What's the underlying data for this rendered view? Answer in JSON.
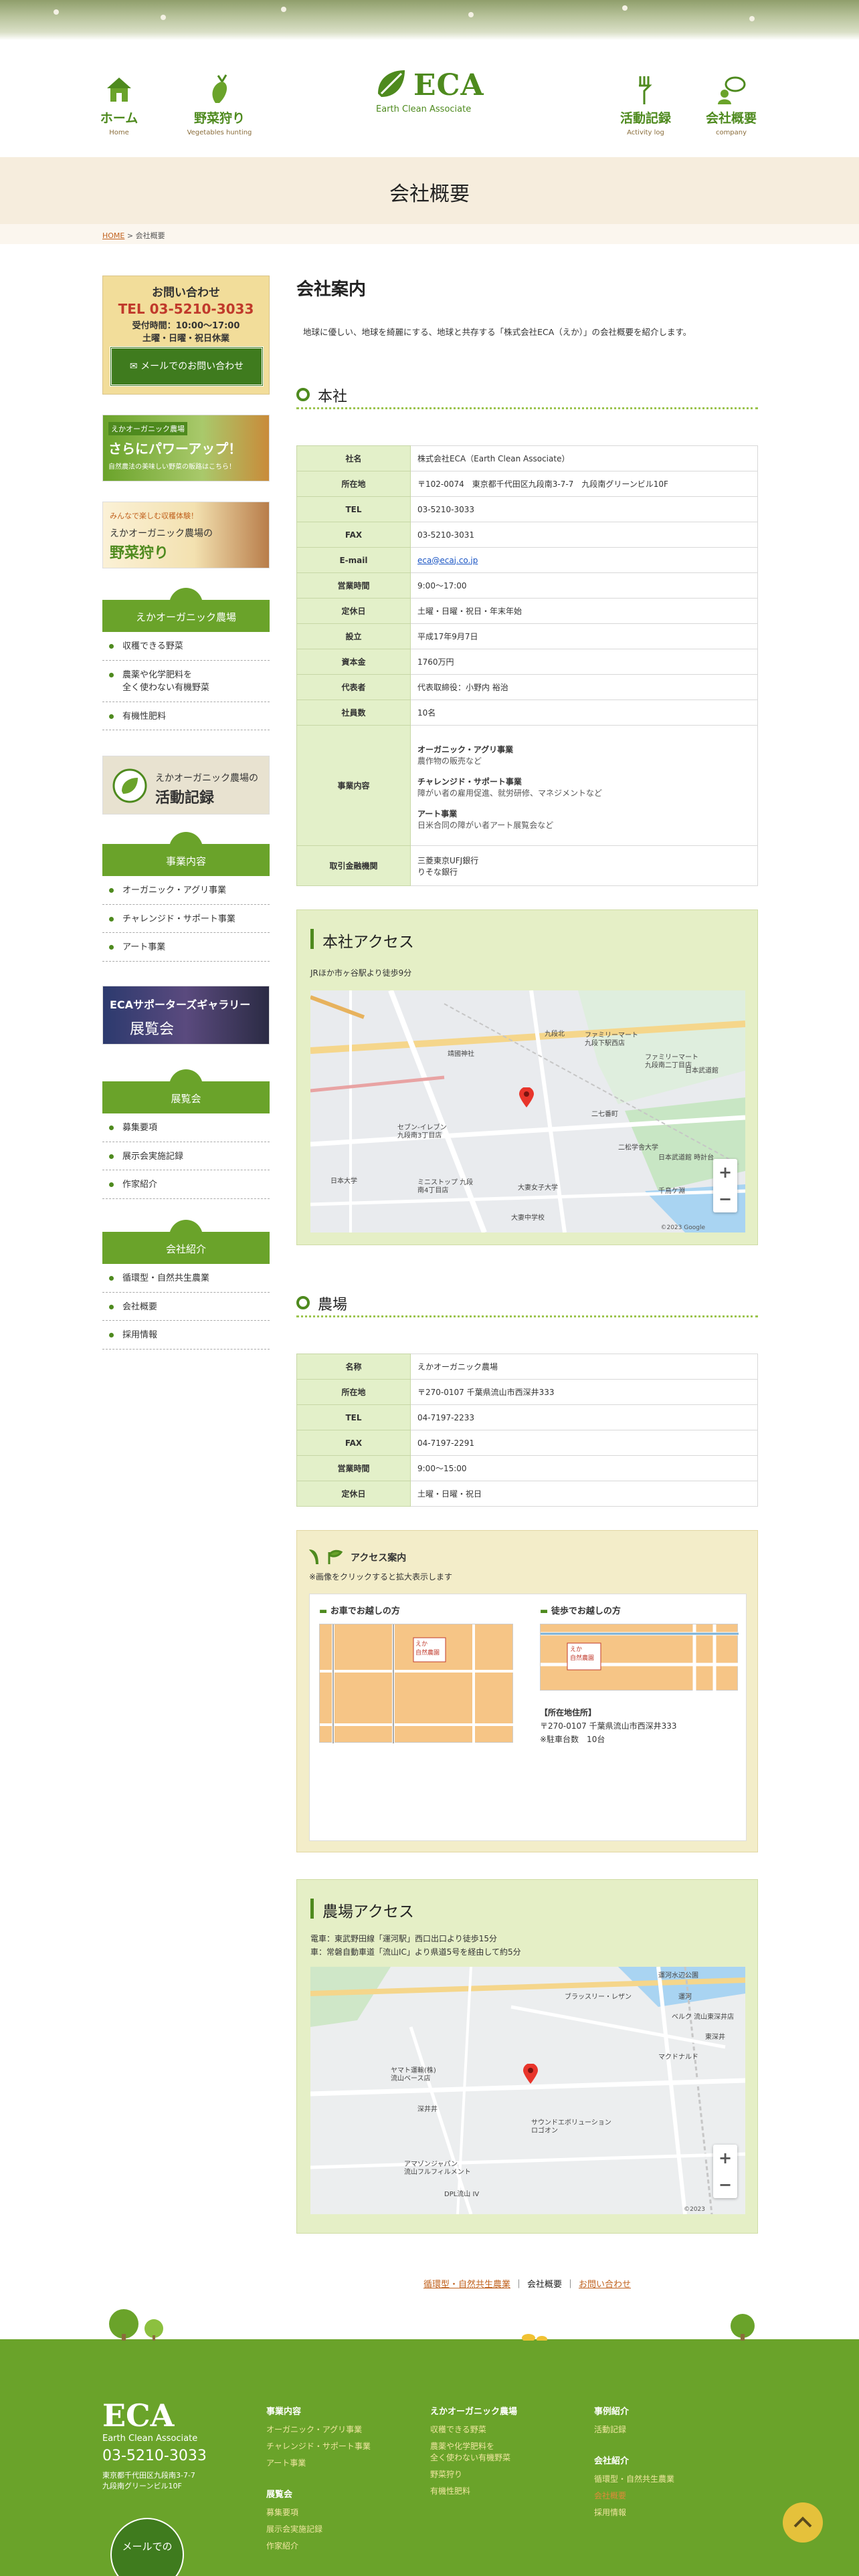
{
  "nav": {
    "home": {
      "jp": "ホーム",
      "en": "Home"
    },
    "harvest": {
      "jp": "野菜狩り",
      "en": "Vegetables hunting"
    },
    "activity": {
      "jp": "活動記録",
      "en": "Activity log"
    },
    "company": {
      "jp": "会社概要",
      "en": "company"
    }
  },
  "logo": {
    "main": "ECA",
    "sub": "Earth Clean Associate"
  },
  "page_title": "会社概要",
  "breadcrumb": {
    "home": "HOME",
    "sep": " > ",
    "current": "会社概要"
  },
  "sidebar": {
    "contact": {
      "title": "お問い合わせ",
      "tel": "TEL 03-5210-3033",
      "hours": "受付時間：10:00〜17:00",
      "closed": "土曜・日曜・祝日休業",
      "mail_button": "メールでのお問い合わせ"
    },
    "banner1": {
      "line1": "えかオーガニック農場",
      "line2": "さらにパワーアップ！",
      "line3": "自然農法の美味しい野菜の販路はこちら！"
    },
    "banner2": {
      "line1": "みんなで楽しむ収穫体験！",
      "line2": "えかオーガニック農場の",
      "line3": "野菜狩り"
    },
    "farm": {
      "heading": "えかオーガニック農場",
      "items": [
        "収穫できる野菜",
        "農薬や化学肥料を\n全く使わない有機野菜",
        "有機性肥料"
      ]
    },
    "banner3": {
      "line1": "えかオーガニック農場の",
      "line2": "活動記録"
    },
    "business": {
      "heading": "事業内容",
      "items": [
        "オーガニック・アグリ事業",
        "チャレンジド・サポート事業",
        "アート事業"
      ]
    },
    "banner4": {
      "line1": "ECAサポーターズギャラリー",
      "line2": "展覧会"
    },
    "exhibition": {
      "heading": "展覧会",
      "items": [
        "募集要項",
        "展示会実施記録",
        "作家紹介"
      ]
    },
    "company": {
      "heading": "会社紹介",
      "items": [
        "循環型・自然共生農業",
        "会社概要",
        "採用情報"
      ]
    }
  },
  "main": {
    "heading": "会社案内",
    "lead": "地球に優しい、地球を綺麗にする、地球と共存する「株式会社ECA（えか）」の会社概要を紹介します。",
    "hq": {
      "heading": "本社",
      "rows": [
        {
          "k": "社名",
          "v": "株式会社ECA（Earth Clean Associate）"
        },
        {
          "k": "所在地",
          "v": "〒102-0074　東京都千代田区九段南3-7-7　九段南グリーンビル10F"
        },
        {
          "k": "TEL",
          "v": "03-5210-3033"
        },
        {
          "k": "FAX",
          "v": "03-5210-3031"
        },
        {
          "k": "E-mail",
          "v": "eca@ecaj.co.jp"
        },
        {
          "k": "営業時間",
          "v": "9:00〜17:00"
        },
        {
          "k": "定休日",
          "v": "土曜・日曜・祝日・年末年始"
        },
        {
          "k": "設立",
          "v": "平成17年9月7日"
        },
        {
          "k": "資本金",
          "v": "1760万円"
        },
        {
          "k": "代表者",
          "v": "代表取締役：小野内 裕治"
        },
        {
          "k": "社員数",
          "v": "10名"
        }
      ],
      "business_label": "事業内容",
      "business": [
        {
          "t": "オーガニック・アグリ事業",
          "d": "農作物の販売など"
        },
        {
          "t": "チャレンジド・サポート事業",
          "d": "障がい者の雇用促進、就労研修、マネジメントなど"
        },
        {
          "t": "アート事業",
          "d": "日米合同の障がい者アート展覧会など"
        }
      ],
      "bank_label": "取引金融機関",
      "bank": [
        "三菱東京UFJ銀行",
        "りそな銀行"
      ]
    },
    "hq_access": {
      "heading": "本社アクセス",
      "text": "JRほか市ヶ谷駅より徒歩9分",
      "map_labels": [
        "九段北",
        "ファミリーマート\n九段下駅西店",
        "ファミリーマート\n九段南二丁目店",
        "日本武道館",
        "靖國神社",
        "セブン-イレブン\n九段南3丁目店",
        "日本大学",
        "ミニストップ 九段\n南4丁目店",
        "大妻女子大学",
        "二松学舎大学",
        "日本武道館 時計台",
        "千鳥ケ淵",
        "大妻中学校",
        "二七番町"
      ],
      "map_credit": "©2023 Google"
    },
    "farm": {
      "heading": "農場",
      "rows": [
        {
          "k": "名称",
          "v": "えかオーガニック農場"
        },
        {
          "k": "所在地",
          "v": "〒270-0107 千葉県流山市西深井333"
        },
        {
          "k": "TEL",
          "v": "04-7197-2233"
        },
        {
          "k": "FAX",
          "v": "04-7197-2291"
        },
        {
          "k": "営業時間",
          "v": "9:00〜15:00"
        },
        {
          "k": "定休日",
          "v": "土曜・日曜・祝日"
        }
      ]
    },
    "farm_guide": {
      "heading": "アクセス案内",
      "note": "※画像をクリックすると拡大表示します",
      "car": "お車でお越しの方",
      "walk": "徒歩でお越しの方",
      "farm_name": "えか\n自然農園",
      "addr_label": "【所在地住所】",
      "addr": "〒270-0107 千葉県流山市西深井333",
      "parking": "※駐車台数　10台"
    },
    "farm_access": {
      "heading": "農場アクセス",
      "text1": "電車：東武野田線「運河駅」西口出口より徒歩15分",
      "text2": "車：常磐自動車道「流山IC」より県道5号を経由して約5分",
      "map_labels": [
        "運河水辺公園",
        "ブラッスリー・レザン",
        "マクドナルド",
        "ヤマト運輸(株)\n流山ベース店",
        "深井井",
        "東深井",
        "サウンドエボリューション\nロゴオン",
        "アマゾンジャパン\n流山フルフィルメント",
        "DPL流山 IV",
        "ベルク 流山東深井店",
        "運河"
      ],
      "map_credit": "©2023"
    },
    "bottom_links": [
      "循環型・自然共生農業",
      "会社概要",
      "お問い合わせ"
    ]
  },
  "footer": {
    "logo_main": "ECA",
    "logo_sub": "Earth Clean Associate",
    "tel": "03-5210-3033",
    "addr1": "東京都千代田区九段南3-7-7",
    "addr2": "九段南グリーンビル10F",
    "mail_btn": "メールでの",
    "col1": {
      "h": "事業内容",
      "items": [
        "オーガニック・アグリ事業",
        "チャレンジド・サポート事業",
        "アート事業"
      ]
    },
    "col1b": {
      "h": "展覧会",
      "items": [
        "募集要項",
        "展示会実施記録",
        "作家紹介"
      ]
    },
    "col2": {
      "h": "えかオーガニック農場",
      "items": [
        "収穫できる野菜",
        "農薬や化学肥料を\n全く使わない有機野菜",
        "野菜狩り",
        "有機性肥料"
      ]
    },
    "col3": {
      "h": "事例紹介",
      "items": [
        "活動記録"
      ]
    },
    "col3b": {
      "h": "会社紹介",
      "items": [
        "循環型・自然共生農業",
        "会社概要",
        "採用情報"
      ]
    }
  },
  "colors": {
    "green": "#4e8a1e",
    "light_green": "#6aa32a",
    "link_orange": "#c1621e",
    "table_head": "#e3f0c9"
  }
}
